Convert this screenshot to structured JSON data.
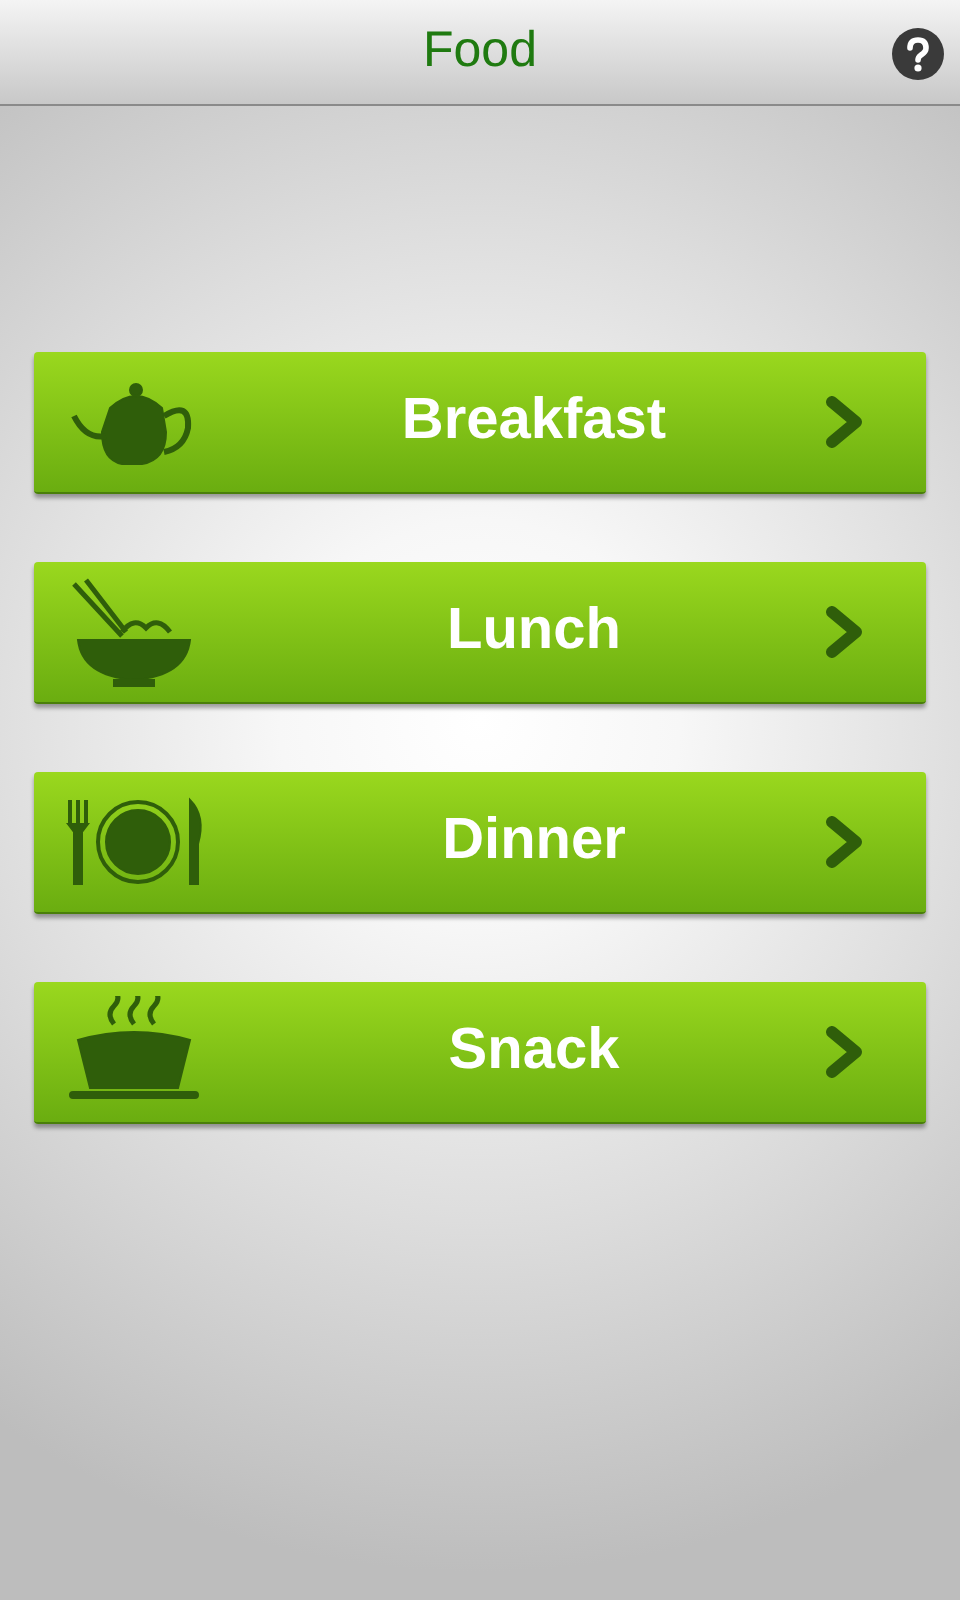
{
  "header": {
    "title": "Food"
  },
  "meals": [
    {
      "kind": "teapot",
      "label": "Breakfast"
    },
    {
      "kind": "bowl",
      "label": "Lunch"
    },
    {
      "kind": "plate",
      "label": "Dinner"
    },
    {
      "kind": "soup",
      "label": "Snack"
    }
  ]
}
